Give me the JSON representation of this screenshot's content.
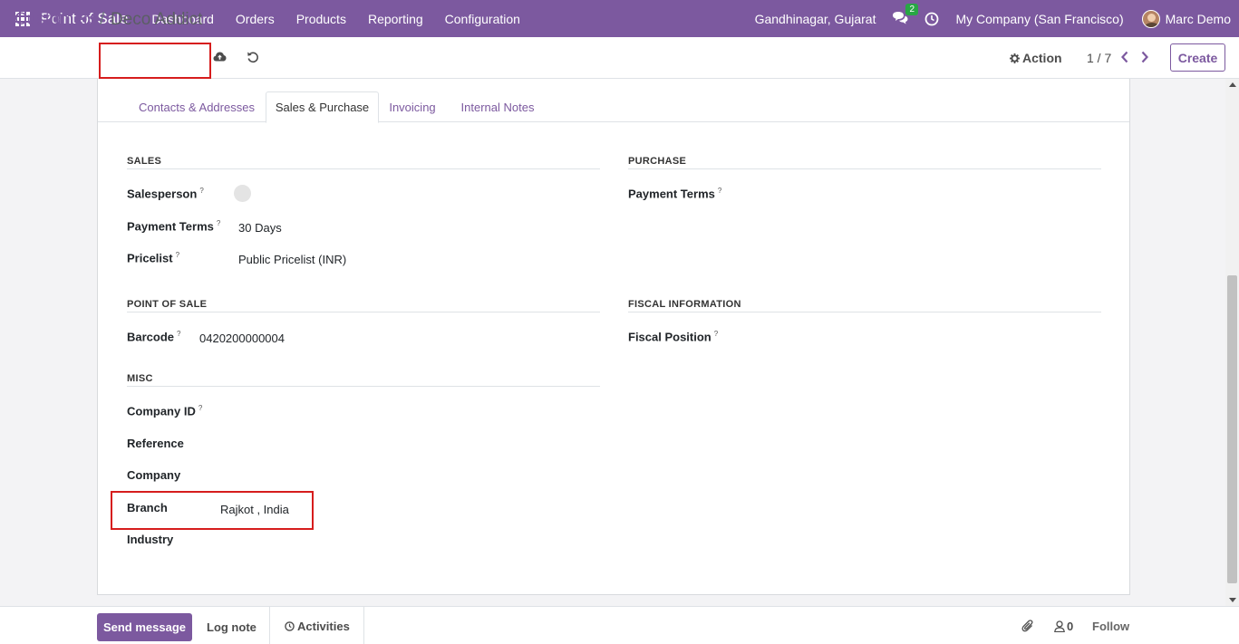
{
  "navbar": {
    "app_name": "Point of Sale",
    "menu": [
      "Dashboard",
      "Orders",
      "Products",
      "Reporting",
      "Configuration"
    ],
    "location": "Gandhinagar, Gujarat",
    "message_count": "2",
    "company": "My Company (San Francisco)",
    "user": "Marc Demo",
    "color": "#7c599f"
  },
  "control": {
    "breadcrumb_root": "Customers",
    "breadcrumb_sep": "/",
    "breadcrumb_current": "Deco Addict",
    "action_label": "Action",
    "pager": "1 / 7",
    "create_label": "Create"
  },
  "tabs": [
    "Contacts & Addresses",
    "Sales & Purchase",
    "Invoicing",
    "Internal Notes"
  ],
  "active_tab": "Sales & Purchase",
  "sales": {
    "title": "SALES",
    "salesperson_label": "Salesperson",
    "payment_terms_label": "Payment Terms",
    "payment_terms_value": "30 Days",
    "pricelist_label": "Pricelist",
    "pricelist_value": "Public Pricelist (INR)"
  },
  "purchase": {
    "title": "PURCHASE",
    "payment_terms_label": "Payment Terms"
  },
  "pos": {
    "title": "POINT OF SALE",
    "barcode_label": "Barcode",
    "barcode_value": "0420200000004"
  },
  "fiscal": {
    "title": "FISCAL INFORMATION",
    "fiscal_position_label": "Fiscal Position"
  },
  "misc": {
    "title": "MISC",
    "company_id_label": "Company ID",
    "reference_label": "Reference",
    "company_label": "Company",
    "branch_label": "Branch",
    "branch_value": "Rajkot , India",
    "industry_label": "Industry"
  },
  "help_mark": "?",
  "chatter": {
    "send_message": "Send message",
    "log_note": "Log note",
    "activities": "Activities",
    "followers_count": "0",
    "follow": "Follow"
  },
  "icons": {
    "apps": "apps-grid-icon",
    "chat": "chat-bubbles-icon",
    "clock": "clock-icon",
    "save": "cloud-upload-icon",
    "discard": "undo-icon",
    "gear": "gear-icon",
    "paperclip": "paperclip-icon",
    "user": "user-icon"
  },
  "highlight_color": "#d61d1d"
}
